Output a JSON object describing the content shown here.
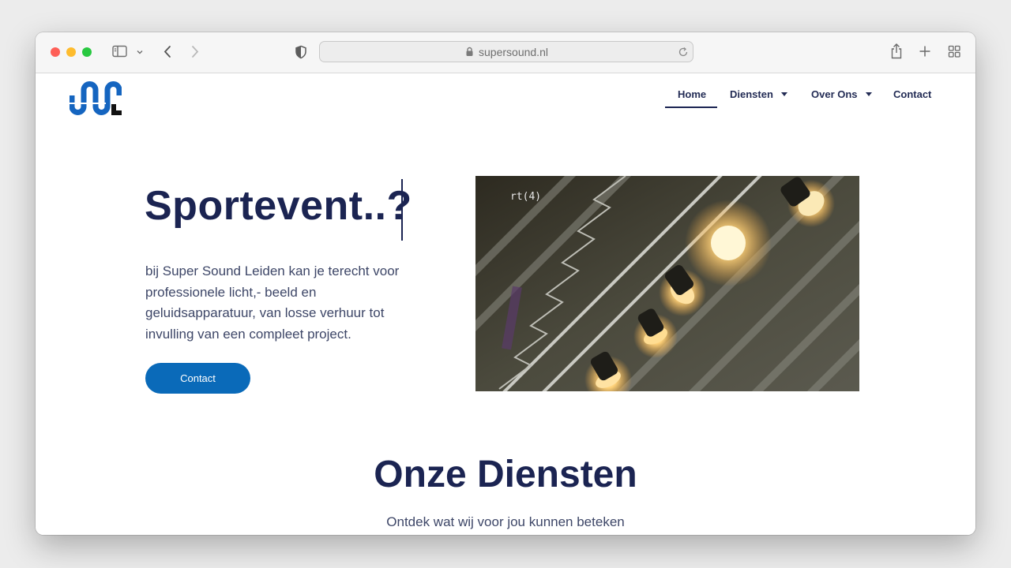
{
  "browser": {
    "url": "supersound.nl"
  },
  "nav": {
    "items": [
      {
        "label": "Home",
        "active": true
      },
      {
        "label": "Diensten",
        "dropdown": true
      },
      {
        "label": "Over Ons",
        "dropdown": true
      },
      {
        "label": "Contact"
      }
    ]
  },
  "hero": {
    "title": "Sportevent..?",
    "text": "bij Super Sound Leiden kan je terecht voor professionele licht,- beeld en geluidsapparatuur, van losse verhuur tot invulling van een compleet project.",
    "button": "Contact",
    "image_overlay_text": "rt(4)"
  },
  "services": {
    "title": "Onze Diensten",
    "subtitle": "Ontdek wat wij voor jou kunnen beteken"
  },
  "colors": {
    "brand_navy": "#1b2452",
    "brand_blue": "#0a6ab9",
    "logo_blue": "#1565c0"
  },
  "icons": [
    "sidebar-icon",
    "chevron-down-icon",
    "back-icon",
    "forward-icon",
    "shield-icon",
    "lock-icon",
    "reload-icon",
    "share-icon",
    "plus-icon",
    "tabs-grid-icon"
  ]
}
